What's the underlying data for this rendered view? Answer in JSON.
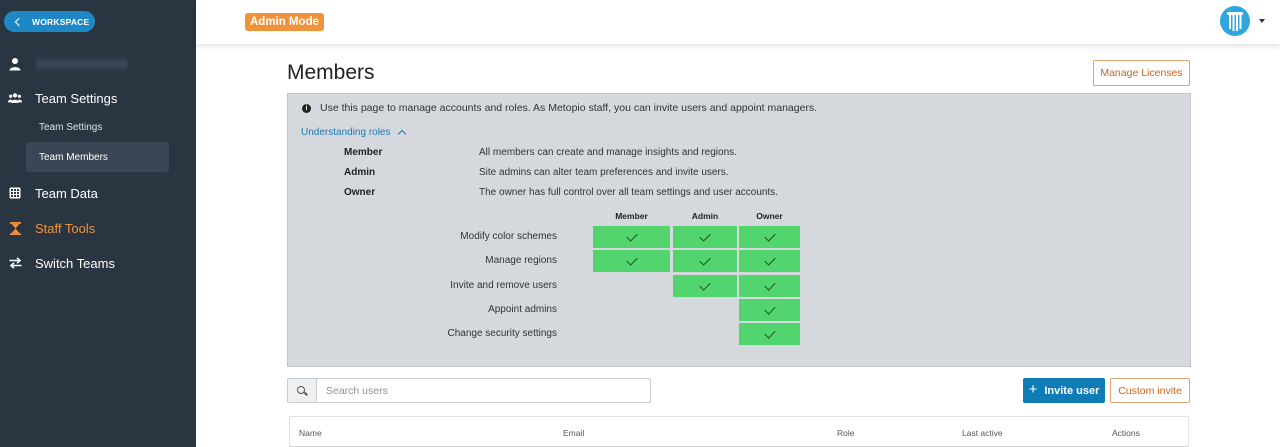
{
  "sidebar": {
    "workspace_label": "WORKSPACE",
    "nav": {
      "team_settings": "Team Settings",
      "team_data": "Team Data",
      "staff_tools": "Staff Tools",
      "switch_teams": "Switch Teams"
    },
    "sub": {
      "team_settings": "Team Settings",
      "team_members": "Team Members"
    }
  },
  "topbar": {
    "admin_mode": "Admin Mode"
  },
  "page": {
    "title": "Members",
    "manage_licenses": "Manage Licenses"
  },
  "info": {
    "text": "Use this page to manage accounts and roles. As Metopio staff, you can invite users and appoint managers.",
    "understanding_roles": "Understanding roles",
    "roles": [
      {
        "name": "Member",
        "desc": "All members can create and manage insights and regions."
      },
      {
        "name": "Admin",
        "desc": "Site admins can alter team preferences and invite users."
      },
      {
        "name": "Owner",
        "desc": "The owner has full control over all team settings and user accounts."
      }
    ],
    "permissions": {
      "columns": [
        "Member",
        "Admin",
        "Owner"
      ],
      "rows": [
        {
          "label": "Modify color schemes",
          "allowed": [
            true,
            true,
            true
          ]
        },
        {
          "label": "Manage regions",
          "allowed": [
            true,
            true,
            true
          ]
        },
        {
          "label": "Invite and remove users",
          "allowed": [
            false,
            true,
            true
          ]
        },
        {
          "label": "Appoint admins",
          "allowed": [
            false,
            false,
            true
          ]
        },
        {
          "label": "Change security settings",
          "allowed": [
            false,
            false,
            true
          ]
        }
      ]
    }
  },
  "search": {
    "placeholder": "Search users",
    "value": ""
  },
  "actions": {
    "invite_user": "Invite user",
    "custom_invite": "Custom invite"
  },
  "table": {
    "headers": [
      "Name",
      "Email",
      "Role",
      "Last active",
      "Actions"
    ]
  },
  "colors": {
    "sidebar_bg": "#2a3542",
    "accent_orange": "#f0923a",
    "primary_blue": "#0f7cb6",
    "permission_green": "#52d56e"
  },
  "icons": {
    "workspace_back": "chevron-left-icon",
    "user": "user-icon",
    "team_settings": "users-icon",
    "team_data": "table-icon",
    "staff_tools": "hourglass-icon",
    "switch_teams": "swap-arrows-icon",
    "info": "info-icon",
    "search": "search-icon",
    "invite": "plus-icon",
    "check": "check-icon"
  }
}
